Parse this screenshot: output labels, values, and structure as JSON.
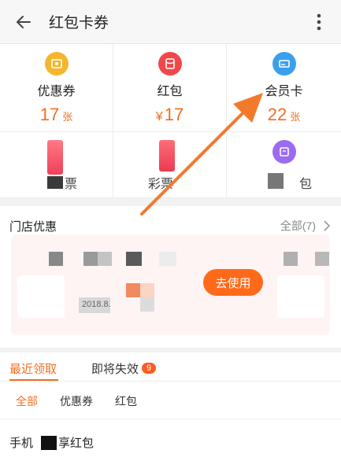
{
  "header": {
    "title": "红包卡券",
    "back_icon": "arrow-left-icon",
    "more_icon": "more-vertical-icon"
  },
  "grid": {
    "items": [
      {
        "label": "优惠券",
        "count": "17",
        "unit": "张",
        "icon": "coupon-icon",
        "icon_color": "#f5b62e"
      },
      {
        "label": "红包",
        "currency": "¥",
        "count": "17",
        "icon": "red-packet-icon",
        "icon_color": "#f0484a"
      },
      {
        "label": "会员卡",
        "count": "22",
        "unit": "张",
        "icon": "member-card-icon",
        "icon_color": "#3aa0ee"
      },
      {
        "label": "票",
        "icon": "ticket-icon"
      },
      {
        "label": "彩票",
        "icon": "lottery-icon"
      },
      {
        "label": "包",
        "icon": "bag-icon",
        "icon_color": "#9b6cf0"
      }
    ]
  },
  "store": {
    "title": "门店优惠",
    "all_label": "全部(7)",
    "use_button": "去使用",
    "date_fragment": "2018.8."
  },
  "tabs": {
    "recent": "最近领取",
    "expiring": "即将失效",
    "expiring_badge": "9",
    "filters": [
      "全部",
      "优惠券",
      "红包"
    ],
    "row_label_prefix": "手机",
    "row_label_suffix": "享红包"
  },
  "colors": {
    "accent": "#f07020",
    "badge": "#ff5a1f",
    "button": "#ff6a1a"
  }
}
